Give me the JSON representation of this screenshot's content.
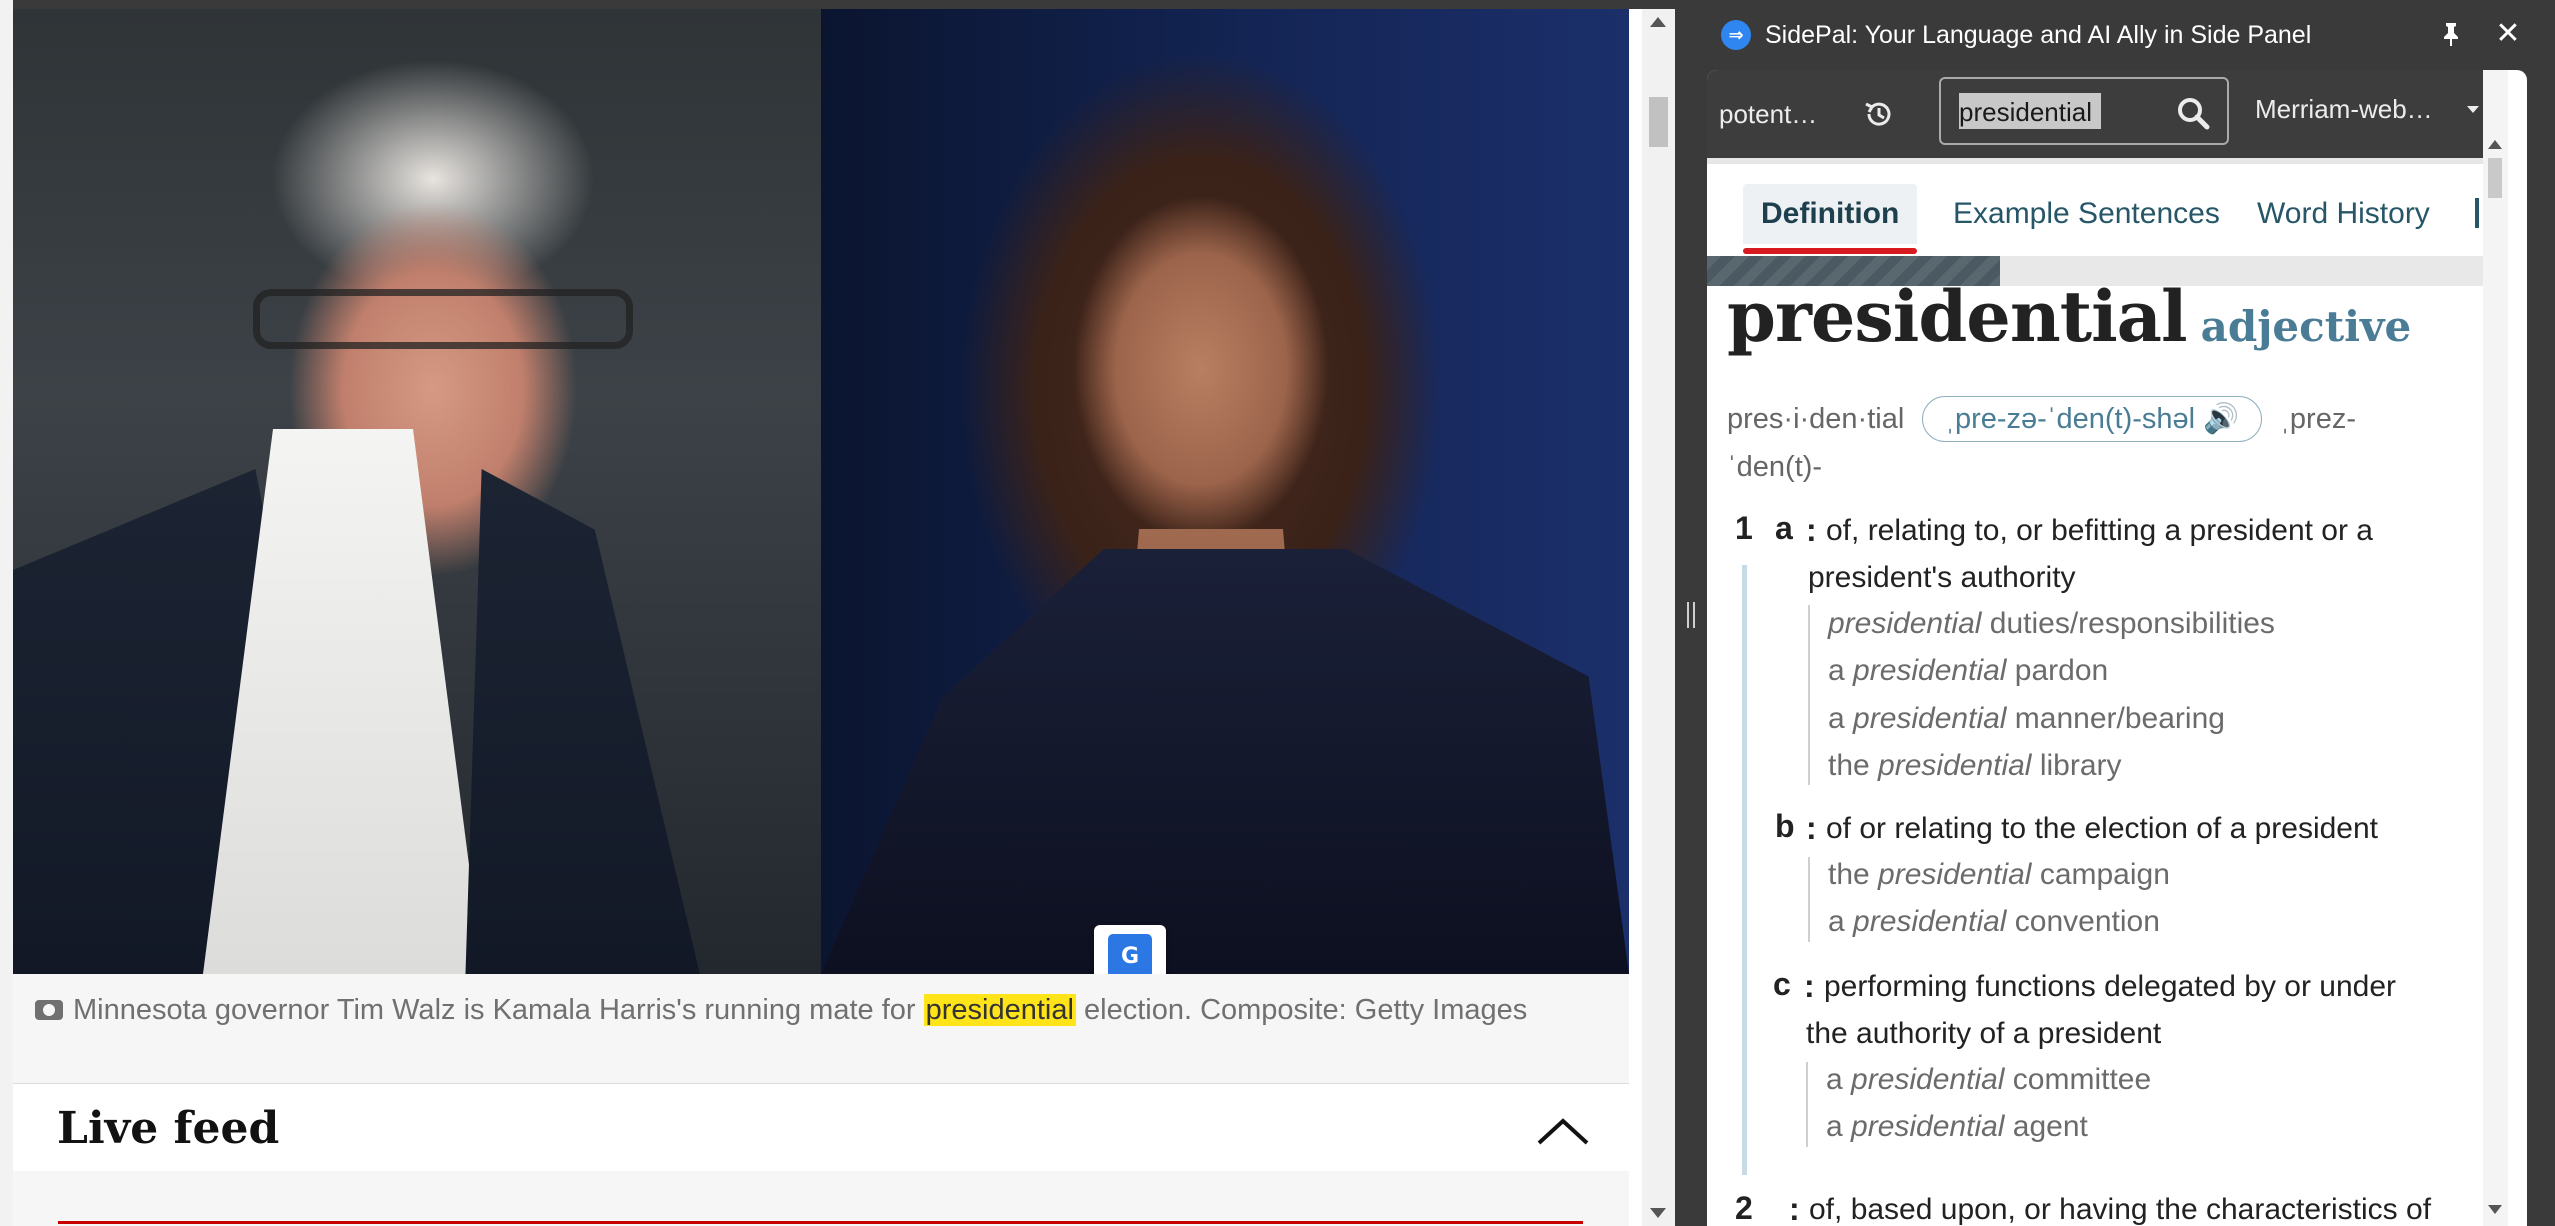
{
  "article": {
    "caption_prefix": "Minnesota governor Tim Walz is Kamala Harris's running mate for ",
    "caption_highlight": "presidential",
    "caption_suffix": " election. Composite: Getty Images",
    "live_feed_title": "Live feed"
  },
  "side_panel": {
    "title": "SidePal: Your Language and AI Ally in Side Panel",
    "history_value": "potent…",
    "search_value": "presidential",
    "dictionary_selected": "Merriam-web…",
    "tabs": [
      "Definition",
      "Example Sentences",
      "Word History"
    ],
    "active_tab": "Definition"
  },
  "entry": {
    "headword": "presidential",
    "function_label": "adjective",
    "hyphenation": "pres·i·den·tial",
    "pronunciation": "ˌpre-zə-ˈden(t)-shəl",
    "alt_pronunciation": "ˌprez-",
    "alt_pronunciation_2": "ˈden(t)-",
    "senses": {
      "num1": "1",
      "a_label": "a",
      "a_def_1": "of, relating to, or befitting a president or a",
      "a_def_2": "president's authority",
      "a_examples": [
        {
          "pre": "",
          "it": "presidential",
          "post": " duties/responsibilities"
        },
        {
          "pre": "a ",
          "it": "presidential",
          "post": " pardon"
        },
        {
          "pre": "a ",
          "it": "presidential",
          "post": " manner/bearing"
        },
        {
          "pre": "the ",
          "it": "presidential",
          "post": " library"
        }
      ],
      "b_label": "b",
      "b_def": "of or relating to the election of a president",
      "b_examples": [
        {
          "pre": "the ",
          "it": "presidential",
          "post": " campaign"
        },
        {
          "pre": "a ",
          "it": "presidential",
          "post": " convention"
        }
      ],
      "c_label": "c",
      "c_def_1": "performing functions delegated by or under",
      "c_def_2": "the authority of a president",
      "c_examples": [
        {
          "pre": "a ",
          "it": "presidential",
          "post": " committee"
        },
        {
          "pre": "a ",
          "it": "presidential",
          "post": " agent"
        }
      ],
      "num2": "2",
      "def2_partial": "of, based upon, or having the characteristics of"
    }
  },
  "icons": {
    "camera": "camera-icon",
    "translate": "google-translate-icon",
    "chevron": "chevron-up-icon",
    "history": "history-icon",
    "search": "search-icon",
    "pin": "pin-icon",
    "close": "close-icon",
    "speaker": "speaker-icon"
  },
  "colors": {
    "highlight": "#ffe41a",
    "accent_red": "#d71920",
    "mw_blue": "#4a7d95",
    "panel_dark": "#3a3a3a"
  }
}
